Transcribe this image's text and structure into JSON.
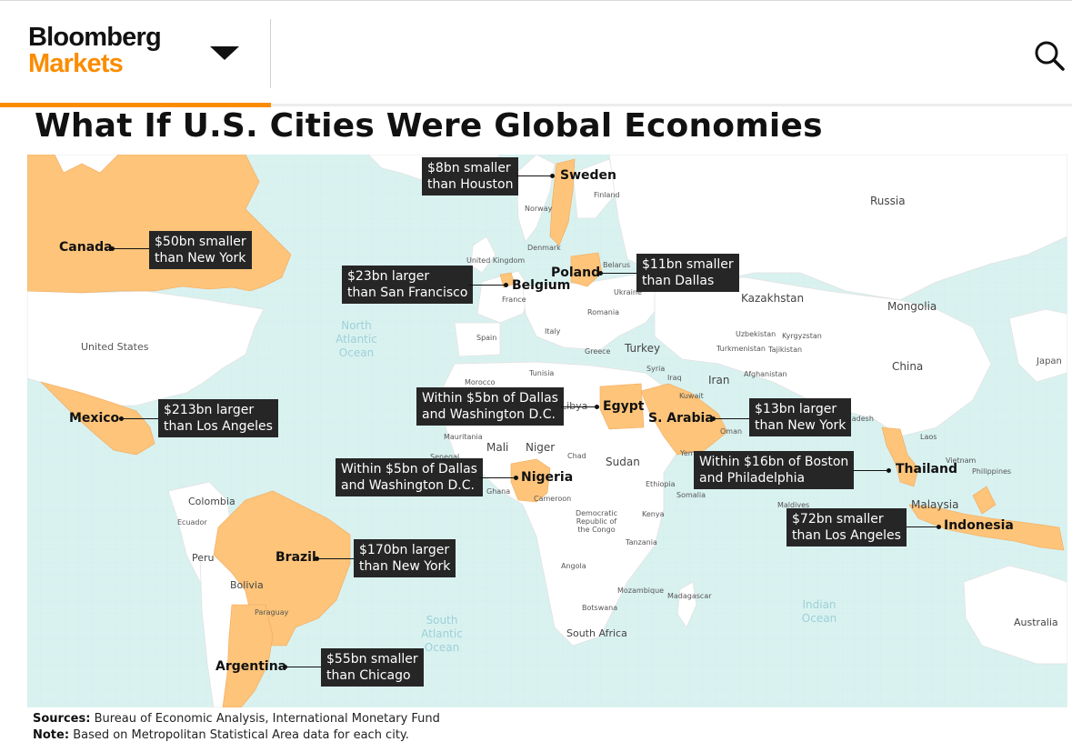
{
  "header": {
    "brand_line1": "Bloomberg",
    "brand_line2": "Markets",
    "brand_color": "#fb8c00",
    "menu_icon": "chevron-down-icon",
    "search_icon": "search-icon"
  },
  "title": "What If U.S. Cities Were Global Economies",
  "map": {
    "highlight_color": "#fdc47a",
    "water_color": "#d9f2f0",
    "oceans": [
      "North Atlantic Ocean",
      "South Atlantic Ocean",
      "Indian Ocean"
    ],
    "highlighted_countries": [
      {
        "name": "Canada",
        "comparison": "$50bn smaller than New York",
        "line1": "$50bn smaller",
        "line2": "than New York"
      },
      {
        "name": "Mexico",
        "comparison": "$213bn larger than Los Angeles",
        "line1": "$213bn larger",
        "line2": "than Los Angeles"
      },
      {
        "name": "Brazil",
        "comparison": "$170bn larger than New York",
        "line1": "$170bn larger",
        "line2": "than New York"
      },
      {
        "name": "Argentina",
        "comparison": "$55bn smaller than Chicago",
        "line1": "$55bn smaller",
        "line2": "than Chicago"
      },
      {
        "name": "Sweden",
        "comparison": "$8bn smaller than Houston",
        "line1": "$8bn smaller",
        "line2": "than Houston"
      },
      {
        "name": "Belgium",
        "comparison": "$23bn larger than San Francisco",
        "line1": "$23bn larger",
        "line2": "than San Francisco"
      },
      {
        "name": "Poland",
        "comparison": "$11bn smaller than Dallas",
        "line1": "$11bn smaller",
        "line2": "than Dallas"
      },
      {
        "name": "Egypt",
        "comparison": "Within $5bn of Dallas and Washington D.C.",
        "line1": "Within $5bn of Dallas",
        "line2": "and Washington D.C."
      },
      {
        "name": "Nigeria",
        "comparison": "Within $5bn of Dallas and Washington D.C.",
        "line1": "Within $5bn of Dallas",
        "line2": "and Washington D.C."
      },
      {
        "name": "S. Arabia",
        "comparison": "$13bn larger than New York",
        "line1": "$13bn larger",
        "line2": "than New York"
      },
      {
        "name": "Thailand",
        "comparison": "Within $16bn of Boston and Philadelphia",
        "line1": "Within $16bn of Boston",
        "line2": "and Philadelphia"
      },
      {
        "name": "Indonesia",
        "comparison": "$72bn smaller than Los Angeles",
        "line1": "$72bn smaller",
        "line2": "than Los Angeles"
      }
    ],
    "other_labels": {
      "russia": "Russia",
      "finland": "Finland",
      "norway": "Norway",
      "denmark": "Denmark",
      "uk": "United Kingdom",
      "belarus": "Belarus",
      "ukraine": "Ukraine",
      "france": "France",
      "romania": "Romania",
      "spain": "Spain",
      "italy": "Italy",
      "greece": "Greece",
      "turkey": "Turkey",
      "kazakhstan": "Kazakhstan",
      "mongolia": "Mongolia",
      "uzbekistan": "Uzbekistan",
      "kyrgyzstan": "Kyrgyzstan",
      "turkmenistan": "Turkmenistan",
      "tajikistan": "Tajikistan",
      "afghanistan": "Afghanistan",
      "china": "China",
      "japan": "Japan",
      "united_states": "United States",
      "syria": "Syria",
      "iraq": "Iraq",
      "iran": "Iran",
      "kuwait": "Kuwait",
      "tunisia": "Tunisia",
      "morocco": "Morocco",
      "libya": "Libya",
      "bangladesh": "Bangladesh",
      "oman": "Oman",
      "yemen": "Yemen",
      "mauritania": "Mauritania",
      "mali": "Mali",
      "niger": "Niger",
      "chad": "Chad",
      "sudan": "Sudan",
      "senegal": "Senegal",
      "ghana": "Ghana",
      "cameroon": "Cameroon",
      "ethiopia": "Ethiopia",
      "somalia": "Somalia",
      "laos": "Laos",
      "vietnam": "Vietnam",
      "philippines": "Philippines",
      "maldives": "Maldives",
      "malaysia": "Malaysia",
      "colombia": "Colombia",
      "ecuador": "Ecuador",
      "peru": "Peru",
      "bolivia": "Bolivia",
      "paraguay": "Paraguay",
      "drc": "Democratic Republic of the Congo",
      "kenya": "Kenya",
      "tanzania": "Tanzania",
      "angola": "Angola",
      "mozambique": "Mozambique",
      "madagascar": "Madagascar",
      "botswana": "Botswana",
      "south_africa": "South Africa",
      "australia": "Australia"
    }
  },
  "footer": {
    "sources_label": "Sources:",
    "sources_text": "Bureau of Economic Analysis, International Monetary Fund",
    "note_label": "Note:",
    "note_text": "Based on Metropolitan Statistical Area data for each city."
  }
}
